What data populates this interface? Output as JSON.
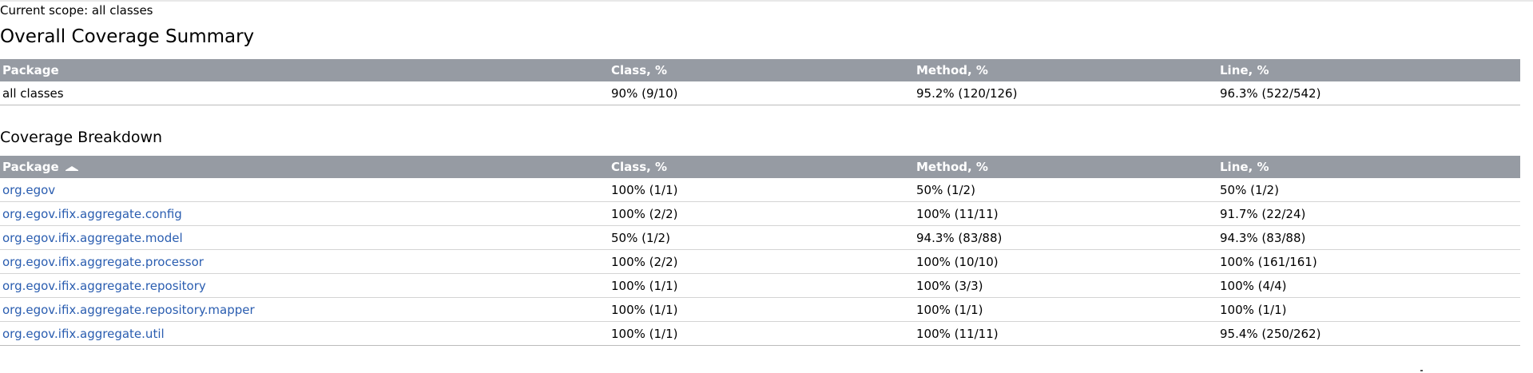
{
  "scope": "Current scope: all classes",
  "summary": {
    "title": "Overall Coverage Summary",
    "headers": {
      "package": "Package",
      "class": "Class, %",
      "method": "Method, %",
      "line": "Line, %"
    },
    "row": {
      "package": "all classes",
      "class": "90% (9/10)",
      "method": "95.2% (120/126)",
      "line": "96.3% (522/542)"
    }
  },
  "breakdown": {
    "title": "Coverage Breakdown",
    "headers": {
      "package": "Package",
      "class": "Class, %",
      "method": "Method, %",
      "line": "Line, %"
    },
    "sort_icon": "sort-ascending-icon",
    "rows": [
      {
        "package": "org.egov",
        "class": "100% (1/1)",
        "method": "50% (1/2)",
        "line": "50% (1/2)"
      },
      {
        "package": "org.egov.ifix.aggregate.config",
        "class": "100% (2/2)",
        "method": "100% (11/11)",
        "line": "91.7% (22/24)"
      },
      {
        "package": "org.egov.ifix.aggregate.model",
        "class": "50% (1/2)",
        "method": "94.3% (83/88)",
        "line": "94.3% (83/88)"
      },
      {
        "package": "org.egov.ifix.aggregate.processor",
        "class": "100% (2/2)",
        "method": "100% (10/10)",
        "line": "100% (161/161)"
      },
      {
        "package": "org.egov.ifix.aggregate.repository",
        "class": "100% (1/1)",
        "method": "100% (3/3)",
        "line": "100% (4/4)"
      },
      {
        "package": "org.egov.ifix.aggregate.repository.mapper",
        "class": "100% (1/1)",
        "method": "100% (1/1)",
        "line": "100% (1/1)"
      },
      {
        "package": "org.egov.ifix.aggregate.util",
        "class": "100% (1/1)",
        "method": "100% (11/11)",
        "line": "95.4% (250/262)"
      }
    ]
  },
  "colors": {
    "header_bg": "#969ba3",
    "link": "#2a5db0",
    "row_border": "#d4d4d4"
  }
}
